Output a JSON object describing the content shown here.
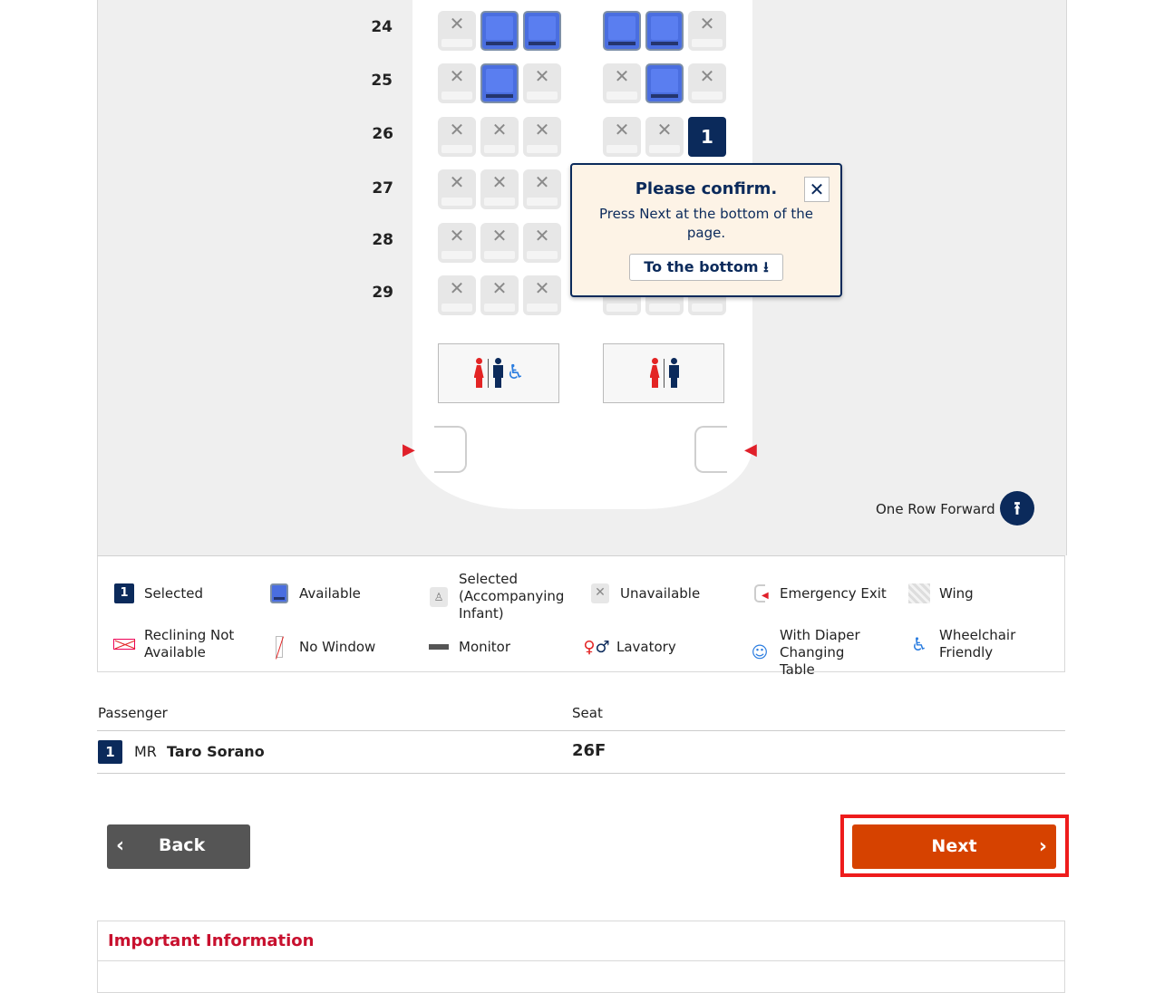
{
  "seat_map": {
    "rows": [
      "24",
      "25",
      "26",
      "27",
      "28",
      "29"
    ],
    "selected_seat_label": "1",
    "x_mark": "✕",
    "one_row_forward_label": "One Row Forward",
    "one_row_forward_icon": "⭱"
  },
  "popup": {
    "title": "Please confirm.",
    "text": "Press Next at the bottom of the page.",
    "close_icon": "✕",
    "to_bottom_label": "To the bottom ⭳"
  },
  "legend": {
    "selected": "Selected",
    "selected_icon_num": "1",
    "available": "Available",
    "selected_infant": "Selected (Accompanying Infant)",
    "unavailable": "Unavailable",
    "emergency_exit": "Emergency Exit",
    "wing": "Wing",
    "reclining": "Reclining Not Available",
    "no_window": "No Window",
    "monitor": "Monitor",
    "lavatory": "Lavatory",
    "diaper": "With Diaper Changing Table",
    "wheelchair": "Wheelchair Friendly"
  },
  "passengers": {
    "col_passenger": "Passenger",
    "col_seat": "Seat",
    "rows": [
      {
        "num": "1",
        "title": "MR",
        "name": "Taro Sorano",
        "seat": "26F"
      }
    ]
  },
  "buttons": {
    "back": "Back",
    "next": "Next"
  },
  "important": {
    "title": "Important Information"
  },
  "colors": {
    "navy": "#0b2a5b",
    "next_orange": "#d64200",
    "seat_blue": "#4a6ee0",
    "important_red": "#c8102e"
  }
}
